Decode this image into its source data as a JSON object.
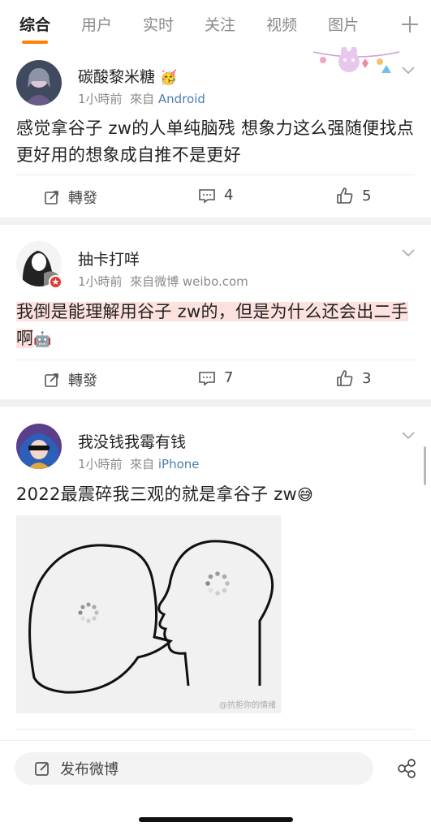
{
  "tabs": {
    "items": [
      "综合",
      "用户",
      "实时",
      "关注",
      "视频",
      "图片"
    ],
    "active_index": 0
  },
  "posts": [
    {
      "username": "碳酸黎米糖",
      "badge_emoji": "🥳",
      "time": "1小時前",
      "source_prefix": "來自",
      "source": "Android",
      "text": "感觉拿谷子 zw的人单纯脑残  想象力这么强随便找点更好用的想象成自推不是更好",
      "repost_label": "轉發",
      "comments": "4",
      "likes": "5"
    },
    {
      "username": "抽卡打咩",
      "time": "1小時前",
      "source_prefix": "來自",
      "source": "微博 weibo.com",
      "text_highlighted": "我倒是能理解用谷子 zw的，但是为什么还会出二手啊",
      "text_emoji": "🤖",
      "repost_label": "轉發",
      "comments": "7",
      "likes": "3"
    },
    {
      "username": "我没钱我霉有钱",
      "time": "1小時前",
      "source_prefix": "來自",
      "source": "iPhone",
      "text": "2022最震碎我三观的就是拿谷子 zw",
      "text_emoji": "😅",
      "image_watermark": "@抗拒你的情绪"
    }
  ],
  "bottom_bar": {
    "compose_label": "发布微博"
  },
  "colors": {
    "accent": "#ff8200",
    "highlight": "#fde1de",
    "link": "#4a7fb0"
  }
}
